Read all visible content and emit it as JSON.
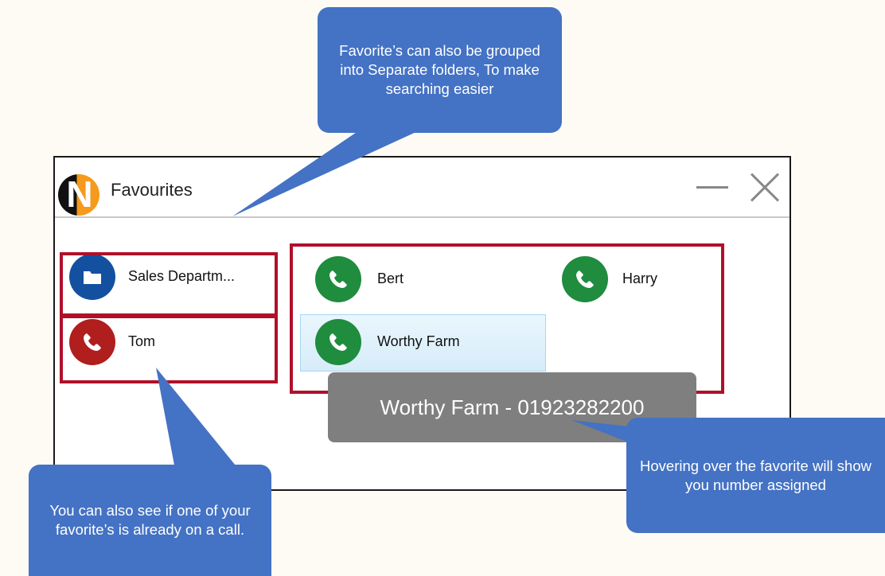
{
  "window": {
    "title": "Favourites",
    "logo_letter": "N"
  },
  "folders": [
    {
      "label": "Sales Departm...",
      "icon": "folder-icon",
      "color": "#1450a0"
    }
  ],
  "contacts": [
    {
      "label": "Tom",
      "status": "on-call",
      "color": "#b01e1e"
    },
    {
      "label": "Bert",
      "status": "available",
      "color": "#1f8c3e"
    },
    {
      "label": "Harry",
      "status": "available",
      "color": "#1f8c3e"
    },
    {
      "label": "Worthy Farm",
      "status": "available",
      "color": "#1f8c3e"
    }
  ],
  "tooltip": {
    "text": "Worthy Farm - 01923282200"
  },
  "callouts": {
    "top": "Favorite’s can also be grouped into Separate folders, To make searching easier",
    "bottom_left": "You can also see if one of your favorite’s is already on a call.",
    "bottom_right": "Hovering over the favorite will show you number assigned"
  },
  "colors": {
    "callout": "#4472c4",
    "highlight_box": "#b0102a",
    "tooltip": "#7f7f7f"
  }
}
